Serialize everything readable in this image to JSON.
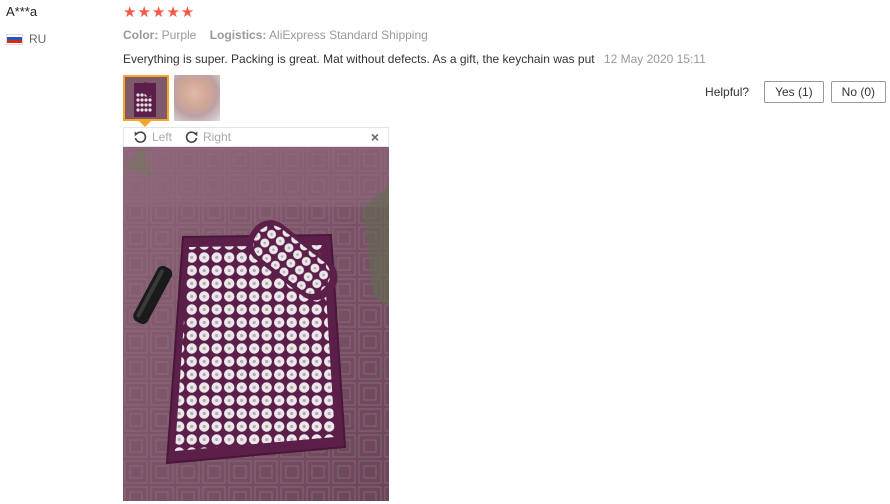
{
  "review": {
    "username": "A***a",
    "country": "RU",
    "rating": "★★★★★",
    "color_label": "Color:",
    "color_value": "Purple",
    "logistics_label": "Logistics:",
    "logistics_value": "AliExpress Standard Shipping",
    "text": "Everything is super. Packing is great. Mat without defects. As a gift, the keychain was put",
    "date": "12 May 2020 15:11"
  },
  "helpful": {
    "question": "Helpful?",
    "yes_label": "Yes (1)",
    "no_label": "No (0)"
  },
  "viewer": {
    "rotate_left": "Left",
    "rotate_right": "Right",
    "close": "×"
  },
  "colors": {
    "star": "#f15a4a",
    "thumb_active_border": "#f5a623",
    "mat_purple": "#5b1f4a",
    "bedspread": "#7e5a6c"
  }
}
